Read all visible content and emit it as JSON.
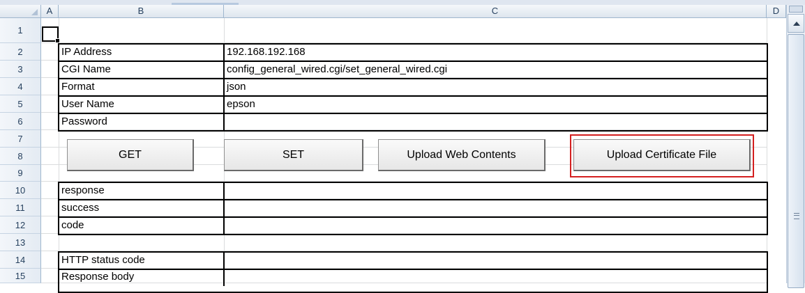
{
  "columns": [
    "A",
    "B",
    "C",
    "D"
  ],
  "rows": [
    "1",
    "2",
    "3",
    "4",
    "5",
    "6",
    "7",
    "8",
    "9",
    "10",
    "11",
    "12",
    "13",
    "14",
    "15"
  ],
  "request_table": [
    {
      "label": "IP Address",
      "value": "192.168.192.168"
    },
    {
      "label": "CGI Name",
      "value": "config_general_wired.cgi/set_general_wired.cgi"
    },
    {
      "label": "Format",
      "value": "json"
    },
    {
      "label": "User Name",
      "value": "epson"
    },
    {
      "label": "Password",
      "value": ""
    }
  ],
  "buttons": {
    "get": "GET",
    "set": "SET",
    "upload_web": "Upload Web Contents",
    "upload_cert": "Upload Certificate File"
  },
  "response_table": [
    {
      "label": "response",
      "value": ""
    },
    {
      "label": "success",
      "value": ""
    },
    {
      "label": "code",
      "value": ""
    }
  ],
  "http_table": [
    {
      "label": "HTTP status code",
      "value": ""
    },
    {
      "label": "Response body",
      "value": ""
    }
  ],
  "colors": {
    "highlight": "#d41f1f",
    "header_text": "#27415f",
    "grid": "#dadcdd"
  }
}
